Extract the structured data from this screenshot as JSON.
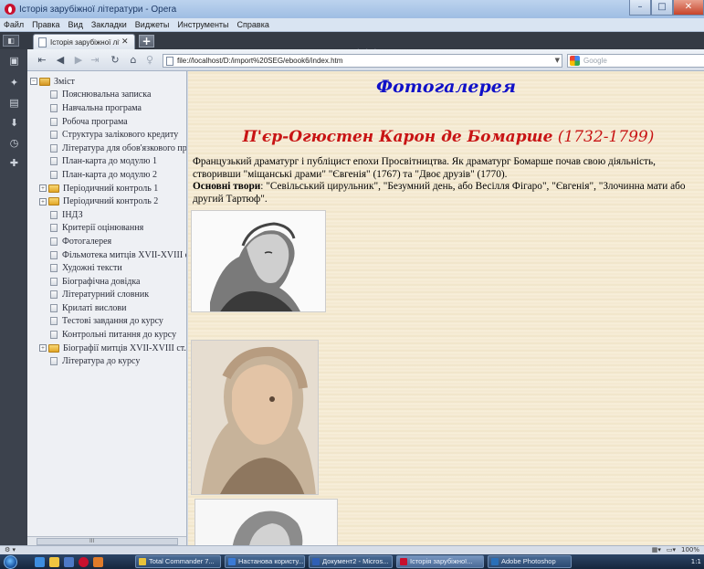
{
  "window": {
    "title": "Історія зарубіжної літератури - Opera",
    "buttons": [
      "–",
      "□",
      "✕"
    ]
  },
  "menu": [
    "Файл",
    "Правка",
    "Вид",
    "Закладки",
    "Виджеты",
    "Инструменты",
    "Справка"
  ],
  "tab": {
    "label": "Історія зарубіжної літе...",
    "close": "✕",
    "new": "+"
  },
  "nav": {
    "address": "file://localhost/D:/import%20SEG/ebook6/index.htm",
    "search_placeholder": "Google"
  },
  "sidebar": {
    "root": "Зміст",
    "items": [
      {
        "label": "Пояснювальна записка",
        "expandable": false
      },
      {
        "label": "Навчальна програма",
        "expandable": false
      },
      {
        "label": "Робоча програма",
        "expandable": false
      },
      {
        "label": "Структура залікового кредиту",
        "expandable": false
      },
      {
        "label": "Література для обов'язкового прочитання",
        "expandable": false
      },
      {
        "label": "План-карта до модулю 1",
        "expandable": false
      },
      {
        "label": "План-карта до модулю 2",
        "expandable": false
      },
      {
        "label": "Періодичний контроль 1",
        "expandable": true
      },
      {
        "label": "Періодичний контроль 2",
        "expandable": true
      },
      {
        "label": "ІНДЗ",
        "expandable": false
      },
      {
        "label": "Критерії оцінювання",
        "expandable": false
      },
      {
        "label": "Фотогалерея",
        "expandable": false
      },
      {
        "label": "Фільмотека митців XVII-XVIII ст.",
        "expandable": false
      },
      {
        "label": "Художні тексти",
        "expandable": false
      },
      {
        "label": "Біографічна довідка",
        "expandable": false
      },
      {
        "label": "Літературний словник",
        "expandable": false
      },
      {
        "label": "Крилаті вислови",
        "expandable": false
      },
      {
        "label": "Тестові завдання до курсу",
        "expandable": false
      },
      {
        "label": "Контрольні питання до курсу",
        "expandable": false
      },
      {
        "label": "Біографії митців XVII-XVIII ст.",
        "expandable": true
      },
      {
        "label": "Література до курсу",
        "expandable": false
      }
    ]
  },
  "content": {
    "title": "Фотогалерея",
    "person_name": "П'єр-Огюстен Карон де Бомарше",
    "person_years": "(1732-1799)",
    "description": "Французький драматург і публіцист епохи Просвітництва. Як драматург Бомарше почав свою діяльність, створивши \"міщанські драми\" \"Євгенія\" (1767) та \"Двоє друзів\" (1770).",
    "works_label": "Основні твори",
    "works": ": \"Севільський цирульник\", \"Безумний день, або Весілля Фігаро\", \"Євгенія\", \"Злочинна мати або другий Тартюф\"."
  },
  "statusbar": {
    "zoom": "100%"
  },
  "taskbar": {
    "tasks": [
      {
        "label": "Total Commander 7...",
        "color": "#e7c23a"
      },
      {
        "label": "Настанова користу...",
        "color": "#3a7ad6"
      },
      {
        "label": "Документ2 - Micros...",
        "color": "#2f5fb5"
      },
      {
        "label": "Історія зарубіжної...",
        "color": "#c8102e"
      },
      {
        "label": "Adobe Photoshop",
        "color": "#2a6fb8"
      }
    ],
    "clock": "1:1"
  }
}
